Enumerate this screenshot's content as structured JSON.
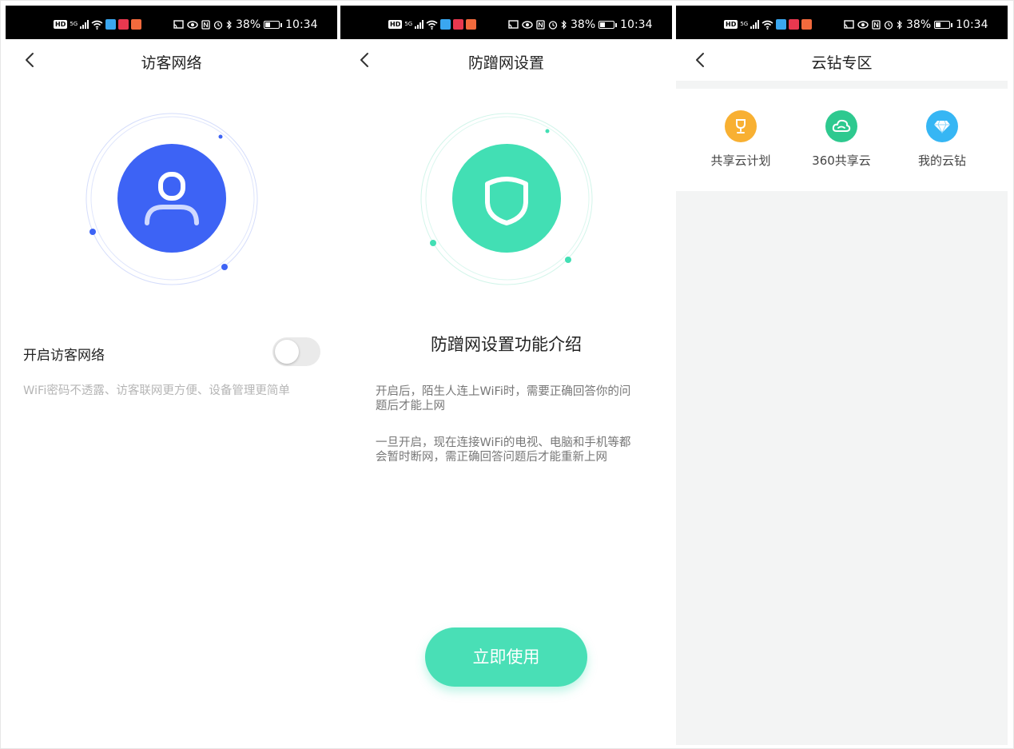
{
  "status_bar": {
    "battery": "38%",
    "time": "10:34",
    "signal_label": "5G",
    "hd_label": "HD"
  },
  "panel_guest": {
    "title": "访客网络",
    "toggle_label": "开启访客网络",
    "toggle_on": false,
    "description": "WiFi密码不透露、访客联网更方便、设备管理更简单",
    "accent_color": "#3d63f5"
  },
  "panel_antileech": {
    "title": "防蹭网设置",
    "heading": "防蹭网设置功能介绍",
    "paragraph_1": "开启后，陌生人连上WiFi时，需要正确回答你的问题后才能上网",
    "paragraph_2": "一旦开启，现在连接WiFi的电视、电脑和手机等都会暂时断网，需正确回答问题后才能重新上网",
    "button_label": "立即使用",
    "accent_color": "#42dfb4"
  },
  "panel_cloud": {
    "title": "云钻专区",
    "items": [
      {
        "label": "共享云计划",
        "icon": "trophy-icon",
        "color": "#f8b032"
      },
      {
        "label": "360共享云",
        "icon": "cloud-icon",
        "color": "#2ec98f"
      },
      {
        "label": "我的云钻",
        "icon": "diamond-icon",
        "color": "#36b6f4"
      }
    ]
  }
}
